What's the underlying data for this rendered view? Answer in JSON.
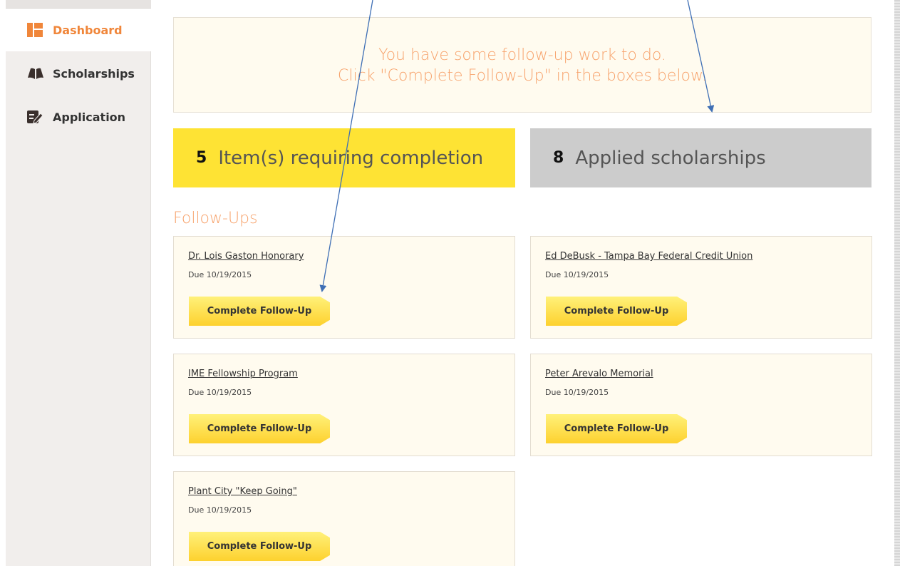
{
  "sidebar": {
    "items": [
      {
        "label": "Dashboard",
        "icon": "dashboard-icon",
        "active": true
      },
      {
        "label": "Scholarships",
        "icon": "book-icon",
        "active": false
      },
      {
        "label": "Application",
        "icon": "edit-icon",
        "active": false
      }
    ]
  },
  "notice": {
    "line1": "You have some follow-up work to do.",
    "line2": "Click \"Complete Follow-Up\" in the boxes below."
  },
  "stats": {
    "pending": {
      "count": "5",
      "label": "Item(s) requiring completion"
    },
    "applied": {
      "count": "8",
      "label": "Applied scholarships"
    }
  },
  "followups": {
    "heading": "Follow-Ups",
    "items": [
      {
        "title": "Dr. Lois Gaston Honorary",
        "due": "Due 10/19/2015",
        "button": "Complete Follow-Up"
      },
      {
        "title": "Ed DeBusk - Tampa Bay Federal Credit Union",
        "due": "Due 10/19/2015",
        "button": "Complete Follow-Up"
      },
      {
        "title": "IME Fellowship Program",
        "due": "Due 10/19/2015",
        "button": "Complete Follow-Up"
      },
      {
        "title": "Peter Arevalo Memorial",
        "due": "Due 10/19/2015",
        "button": "Complete Follow-Up"
      },
      {
        "title": "Plant City \"Keep Going\"",
        "due": "Due 10/19/2015",
        "button": "Complete Follow-Up"
      }
    ]
  },
  "colors": {
    "accent": "#f0863a",
    "notice_text": "#f7a26b",
    "stat_yellow": "#fee334",
    "stat_grey": "#cccccc",
    "annotation_arrow": "#3f6fb5"
  }
}
